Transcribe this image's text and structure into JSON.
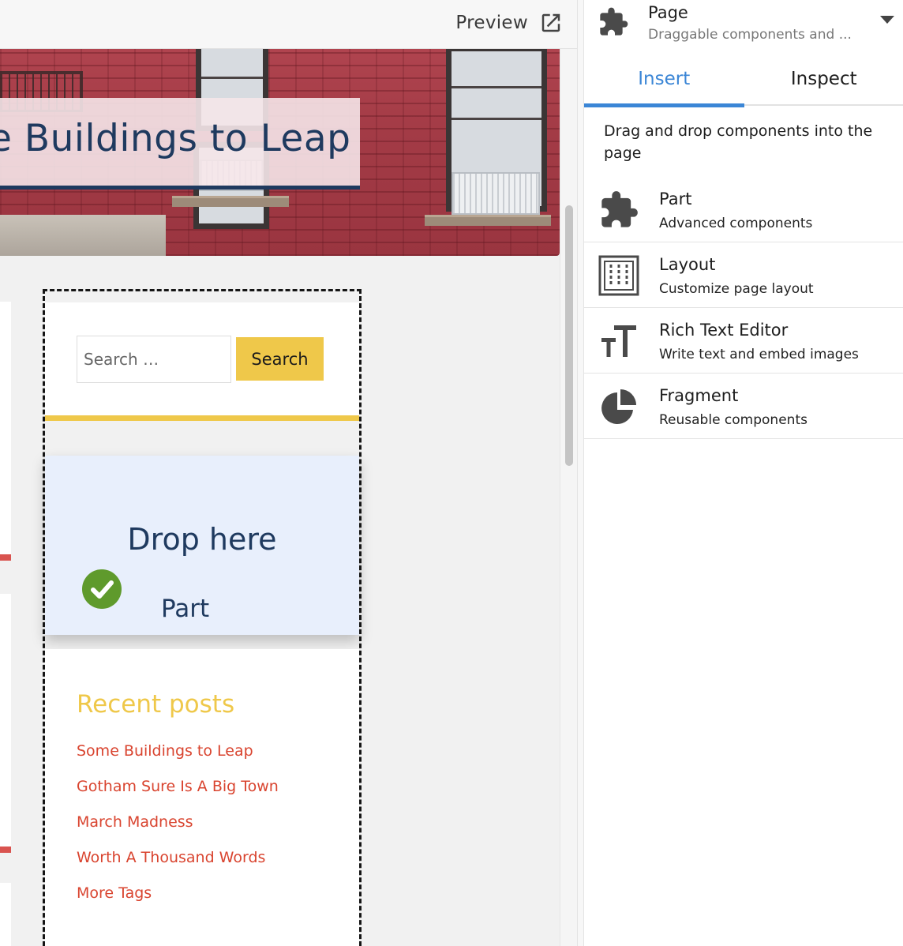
{
  "canvas": {
    "preview_label": "Preview",
    "hero_title": "e Buildings to Leap",
    "search": {
      "placeholder": "Search …",
      "button_label": "Search"
    },
    "drop_zone": {
      "title": "Drop here",
      "component": "Part"
    },
    "recent_posts": {
      "title": "Recent posts",
      "items": [
        "Some Buildings to Leap",
        "Gotham Sure Is A Big Town",
        "March Madness",
        "Worth A Thousand Words",
        "More Tags"
      ]
    }
  },
  "panel": {
    "header": {
      "title": "Page",
      "subtitle": "Draggable components and ...",
      "icon": "puzzle-icon"
    },
    "tabs": [
      {
        "label": "Insert",
        "active": true
      },
      {
        "label": "Inspect",
        "active": false
      }
    ],
    "intro": "Drag and drop components into the page",
    "components": [
      {
        "name": "Part",
        "desc": "Advanced components",
        "icon": "puzzle-icon"
      },
      {
        "name": "Layout",
        "desc": "Customize page layout",
        "icon": "layout-icon"
      },
      {
        "name": "Rich Text Editor",
        "desc": "Write text and embed images",
        "icon": "text-size-icon"
      },
      {
        "name": "Fragment",
        "desc": "Reusable components",
        "icon": "pie-chart-icon"
      }
    ]
  },
  "colors": {
    "accent_blue": "#3b86d6",
    "title_navy": "#1f3a5f",
    "yellow": "#efc84a",
    "link_red": "#d9442f",
    "check_green": "#5f9a2c",
    "drop_bg": "#e8effc"
  }
}
